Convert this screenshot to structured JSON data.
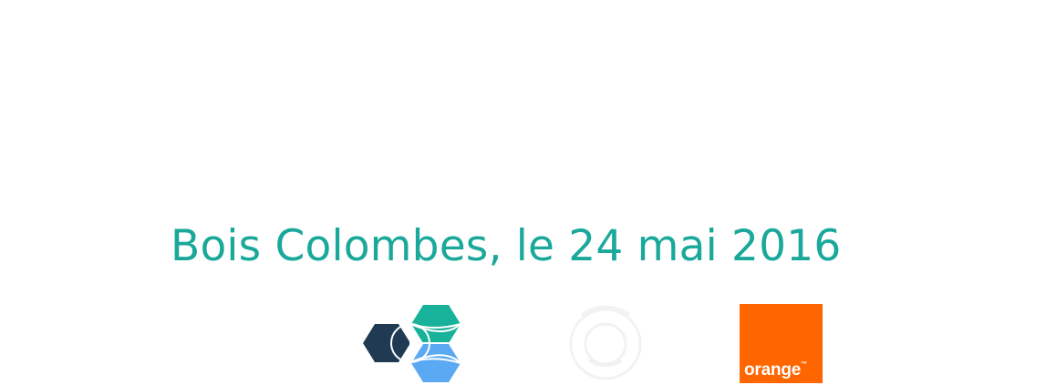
{
  "slide": {
    "date_line": "Bois Colombes, le 24 mai 2016"
  },
  "logos": {
    "orange": {
      "wordmark": "orange",
      "trademark": "™"
    }
  },
  "colors": {
    "title": "#1aa89b",
    "hex_teal": "#18b29a",
    "hex_navy": "#1f3a52",
    "hex_blue": "#5aa9f2",
    "orange_brand": "#ff6600"
  },
  "icons": {
    "hex_logo": "hexagon-cluster-logo-icon",
    "faint_logo": "faded-emblem-logo-icon",
    "orange_logo": "orange-brand-logo"
  }
}
